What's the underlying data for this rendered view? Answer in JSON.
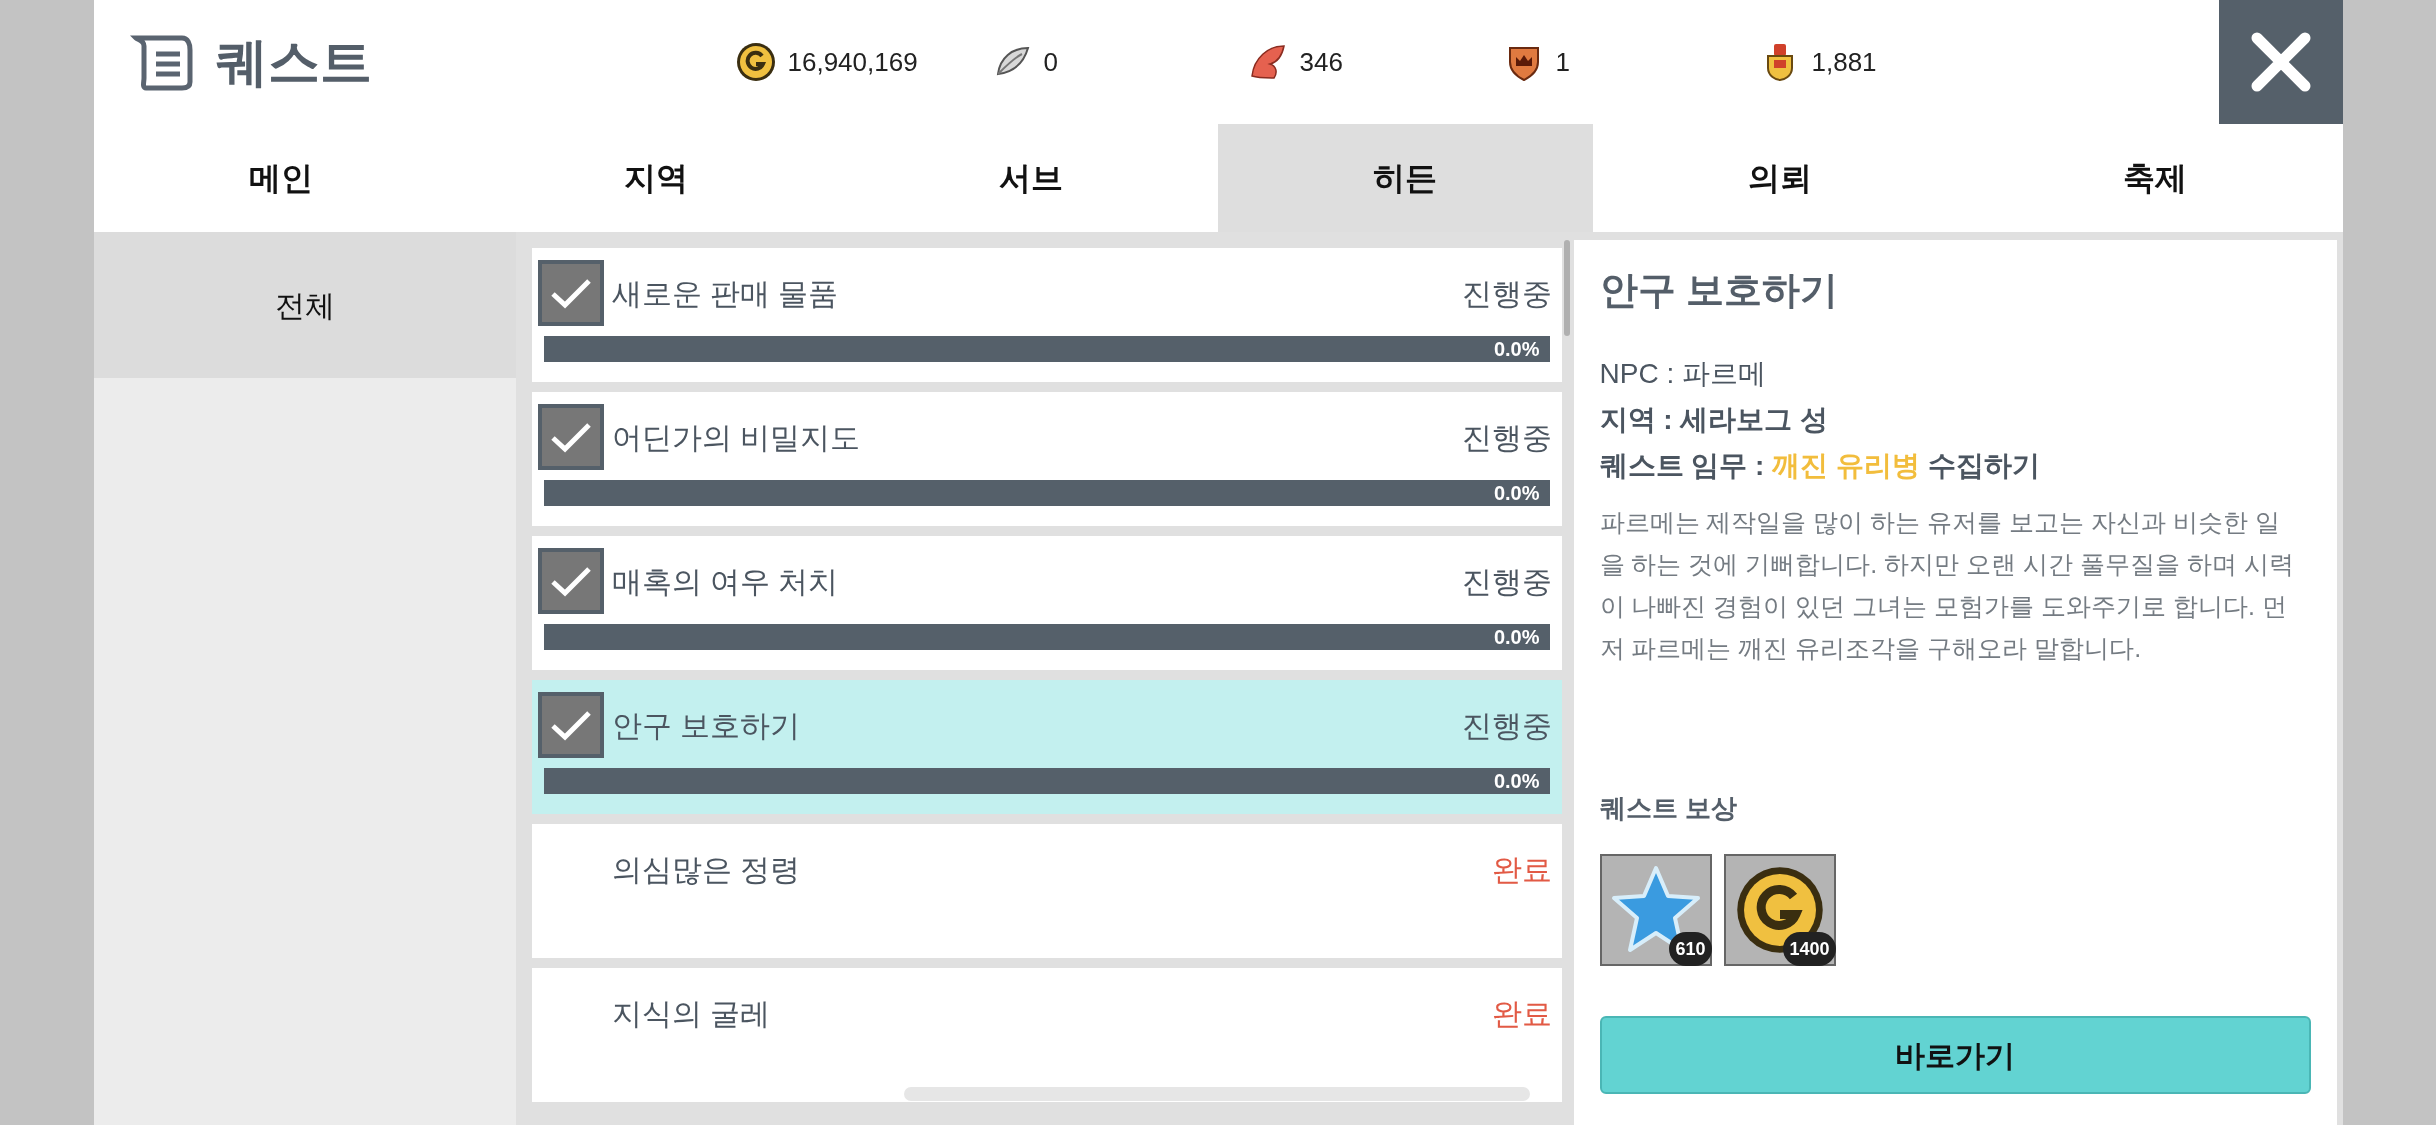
{
  "header": {
    "title": "퀘스트",
    "currencies": [
      {
        "kind": "gold",
        "value": "16,940,169"
      },
      {
        "kind": "feather",
        "value": "0"
      },
      {
        "kind": "leaf",
        "value": "346"
      },
      {
        "kind": "crest",
        "value": "1"
      },
      {
        "kind": "medal",
        "value": "1,881"
      }
    ]
  },
  "tabs": [
    {
      "label": "메인",
      "selected": false
    },
    {
      "label": "지역",
      "selected": false
    },
    {
      "label": "서브",
      "selected": false
    },
    {
      "label": "히든",
      "selected": true
    },
    {
      "label": "의뢰",
      "selected": false
    },
    {
      "label": "축제",
      "selected": false
    }
  ],
  "sidebar": {
    "items": [
      {
        "label": "전체",
        "selected": true
      }
    ]
  },
  "quests": [
    {
      "kind": "in_progress",
      "title": "새로운 판매 물품",
      "status": "진행중",
      "checked": true,
      "selected": false,
      "level": 0,
      "reading": "0.0%"
    },
    {
      "kind": "in_progress",
      "title": "어딘가의 비밀지도",
      "status": "진행중",
      "checked": true,
      "selected": false,
      "level": 0,
      "reading": "0.0%"
    },
    {
      "kind": "in_progress",
      "title": "매혹의 여우 처치",
      "status": "진행중",
      "checked": true,
      "selected": false,
      "level": 0,
      "reading": "0.0%"
    },
    {
      "kind": "in_progress",
      "title": "안구 보호하기",
      "status": "진행중",
      "checked": true,
      "selected": true,
      "level": 0,
      "reading": "0.0%"
    },
    {
      "kind": "done",
      "title": "의심많은 정령",
      "status": "완료",
      "checked": false,
      "selected": false
    },
    {
      "kind": "done",
      "title": "지식의 굴레",
      "status": "완료",
      "checked": false,
      "selected": false
    }
  ],
  "detail": {
    "title": "안구 보호하기",
    "npc": "NPC : 파르메",
    "region": "지역 : 세라보그 성",
    "task": {
      "label": "퀘스트 임무 :",
      "target": "깨진 유리병",
      "rest": "수집하기"
    },
    "description": "파르메는 제작일을 많이 하는 유저를 보고는 자신과 비슷한 일을 하는 것에 기뻐합니다. 하지만 오랜 시간 풀무질을 하며 시력이 나빠진 경험이 있던 그녀는 모험가를 도와주기로 합니다. 먼저 파르메는 깨진 유리조각을 구해오라 말합니다.",
    "rewards_title": "퀘스트 보상",
    "rewards": [
      {
        "kind": "star",
        "count": "610"
      },
      {
        "kind": "gold",
        "count": "1400"
      }
    ],
    "go_button": "바로가기"
  }
}
